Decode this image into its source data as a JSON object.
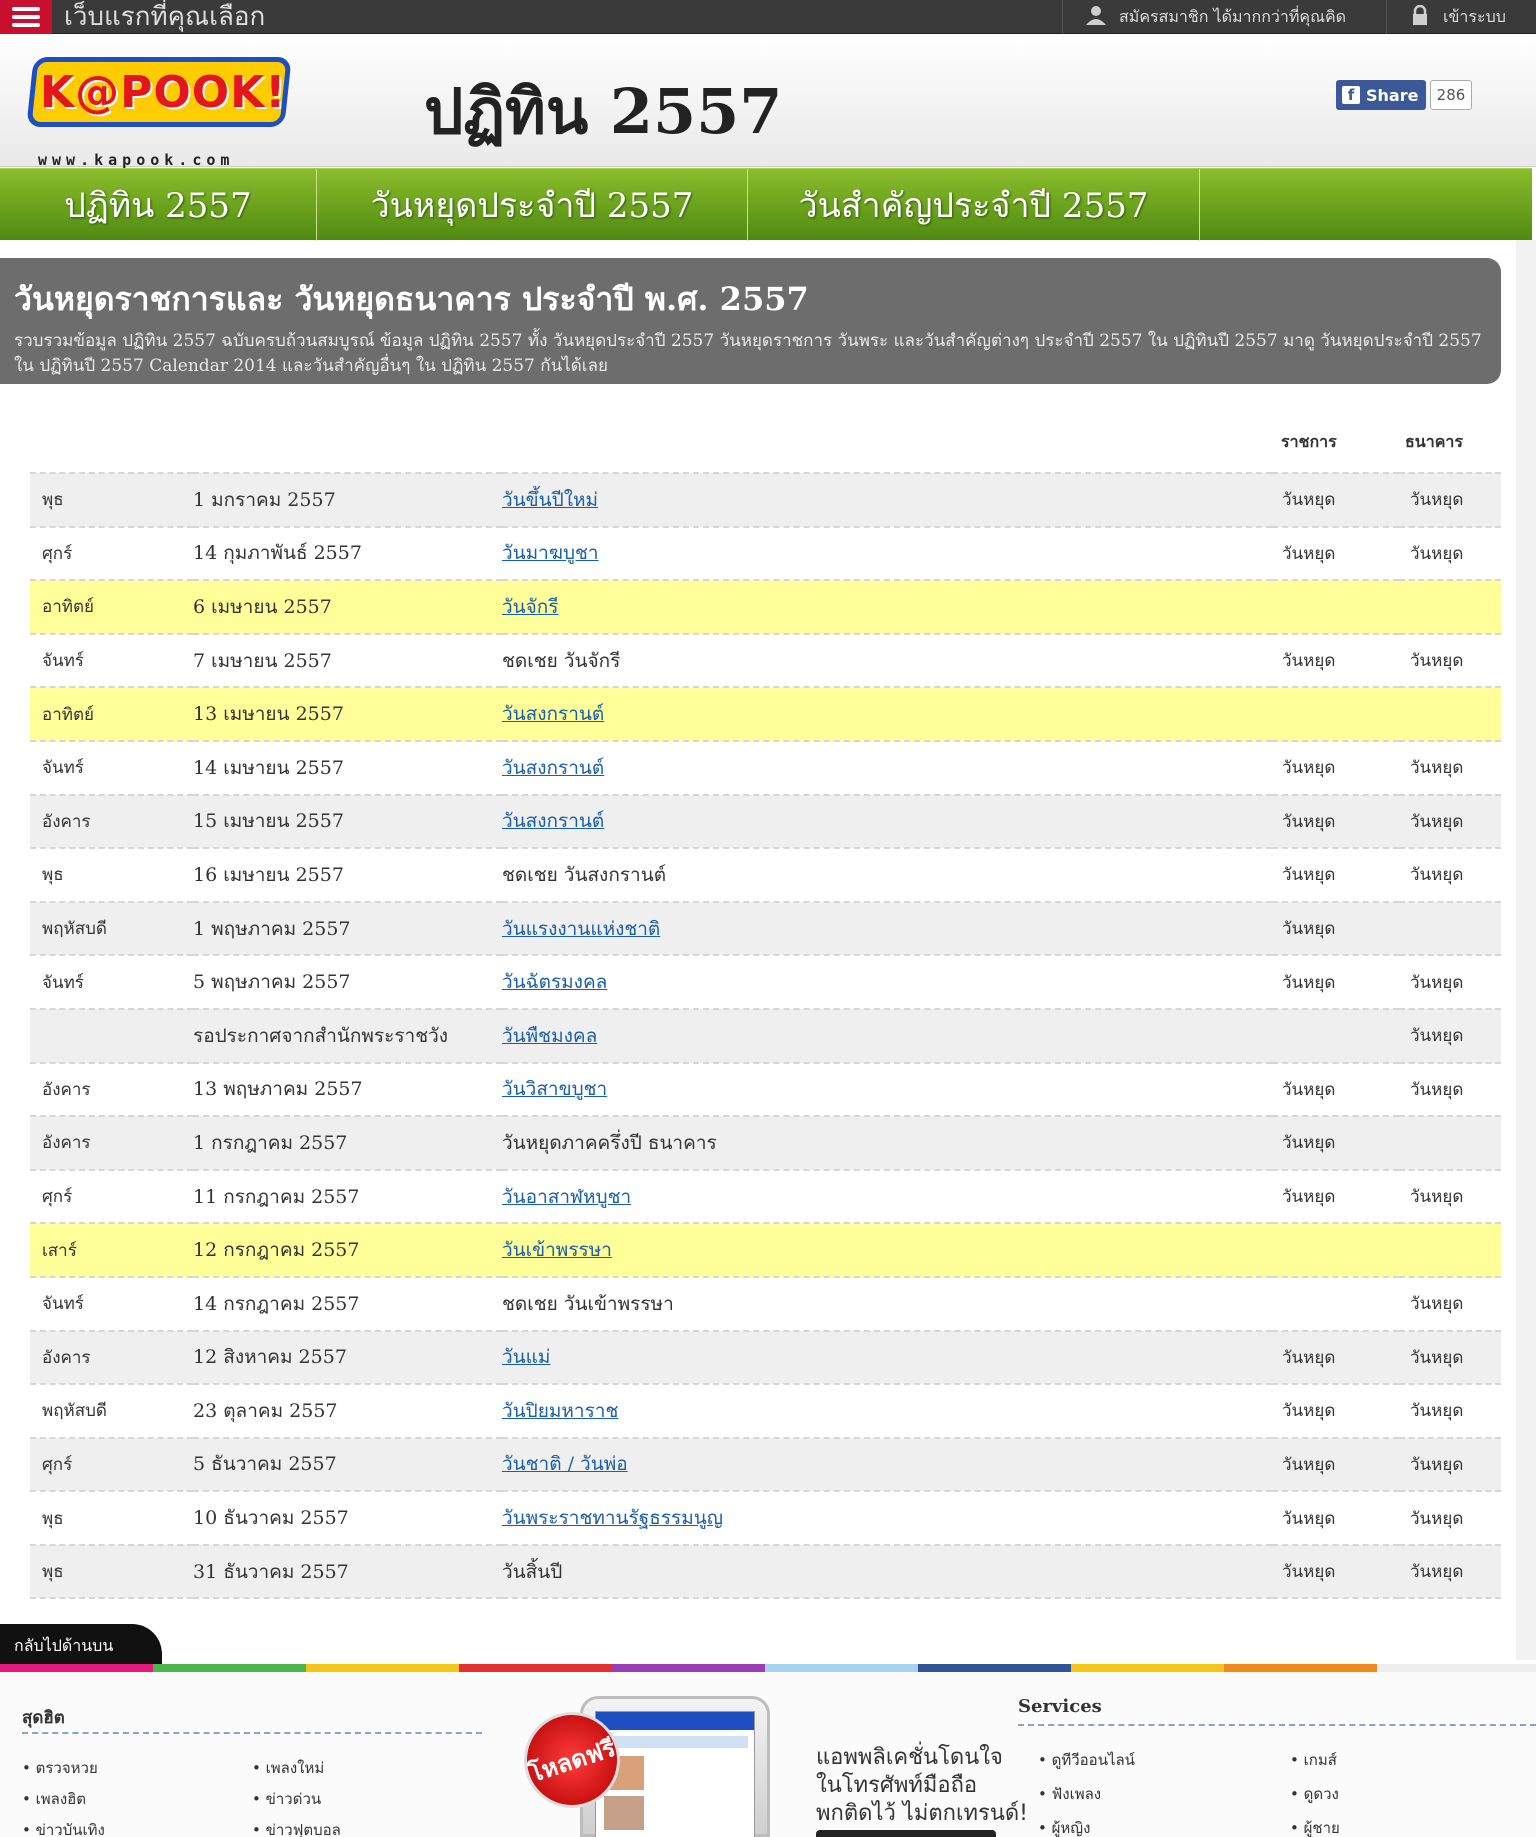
{
  "topbar": {
    "tagline": "เว็บแรกที่คุณเลือก",
    "member_label": "สมัครสมาชิก ได้มากกว่าที่คุณคิด",
    "login_label": "เข้าระบบ"
  },
  "header": {
    "logo_text": "K@POOK!",
    "logo_url": "www.kapook.com",
    "title": "ปฏิทิน 2557",
    "share_label": "Share",
    "share_count": "286"
  },
  "nav": {
    "items": [
      {
        "label": "ปฏิทิน 2557"
      },
      {
        "label": "วันหยุดประจำปี 2557"
      },
      {
        "label": "วันสำคัญประจำปี 2557"
      }
    ]
  },
  "intro": {
    "heading": "วันหยุดราชการและ วันหยุดธนาคาร ประจำปี พ.ศ. 2557",
    "text": "รวบรวมข้อมูล ปฏิทิน 2557 ฉบับครบถ้วนสมบูรณ์ ข้อมูล ปฏิทิน 2557 ทั้ง วันหยุดประจำปี 2557 วันหยุดราชการ วันพระ และวันสำคัญต่างๆ ประจำปี 2557 ใน ปฏิทินปี 2557 มาดู วันหยุดประจำปี 2557 ใน ปฏิทินปี 2557 Calendar 2014 และวันสำคัญอื่นๆ ใน ปฏิทิน 2557 กันได้เลย"
  },
  "table": {
    "col_gov": "ราชการ",
    "col_bank": "ธนาคาร",
    "rows": [
      {
        "day": "พุธ",
        "date": "1 มกราคม 2557",
        "name": "วันขึ้นปีใหม่",
        "link": true,
        "gov": "วันหยุด",
        "bank": "วันหยุด",
        "weekend": false
      },
      {
        "day": "ศุกร์",
        "date": "14 กุมภาพันธ์ 2557",
        "name": "วันมาฆบูชา",
        "link": true,
        "gov": "วันหยุด",
        "bank": "วันหยุด",
        "weekend": false
      },
      {
        "day": "อาทิตย์",
        "date": "6 เมษายน 2557",
        "name": "วันจักรี",
        "link": true,
        "gov": "",
        "bank": "",
        "weekend": true
      },
      {
        "day": "จันทร์",
        "date": "7 เมษายน 2557",
        "name": "ชดเชย วันจักรี",
        "link": false,
        "gov": "วันหยุด",
        "bank": "วันหยุด",
        "weekend": false
      },
      {
        "day": "อาทิตย์",
        "date": "13 เมษายน 2557",
        "name": "วันสงกรานต์",
        "link": true,
        "gov": "",
        "bank": "",
        "weekend": true
      },
      {
        "day": "จันทร์",
        "date": "14 เมษายน 2557",
        "name": "วันสงกรานต์",
        "link": true,
        "gov": "วันหยุด",
        "bank": "วันหยุด",
        "weekend": false
      },
      {
        "day": "อังคาร",
        "date": "15 เมษายน 2557",
        "name": "วันสงกรานต์",
        "link": true,
        "gov": "วันหยุด",
        "bank": "วันหยุด",
        "weekend": false
      },
      {
        "day": "พุธ",
        "date": "16 เมษายน 2557",
        "name": "ชดเชย วันสงกรานต์",
        "link": false,
        "gov": "วันหยุด",
        "bank": "วันหยุด",
        "weekend": false
      },
      {
        "day": "พฤหัสบดี",
        "date": "1 พฤษภาคม 2557",
        "name": "วันแรงงานแห่งชาติ",
        "link": true,
        "gov": "วันหยุด",
        "bank": "",
        "weekend": false
      },
      {
        "day": "จันทร์",
        "date": "5 พฤษภาคม 2557",
        "name": "วันฉัตรมงคล",
        "link": true,
        "gov": "วันหยุด",
        "bank": "วันหยุด",
        "weekend": false
      },
      {
        "day": "",
        "date": "รอประกาศจากสำนักพระราชวัง",
        "name": "วันพืชมงคล",
        "link": true,
        "gov": "",
        "bank": "วันหยุด",
        "weekend": false
      },
      {
        "day": "อังคาร",
        "date": "13 พฤษภาคม 2557",
        "name": "วันวิสาขบูชา",
        "link": true,
        "gov": "วันหยุด",
        "bank": "วันหยุด",
        "weekend": false
      },
      {
        "day": "อังคาร",
        "date": "1 กรกฎาคม 2557",
        "name": "วันหยุดภาคครึ่งปี ธนาคาร",
        "link": false,
        "gov": "วันหยุด",
        "bank": "",
        "weekend": false
      },
      {
        "day": "ศุกร์",
        "date": "11 กรกฎาคม 2557",
        "name": "วันอาสาฬหบูชา",
        "link": true,
        "gov": "วันหยุด",
        "bank": "วันหยุด",
        "weekend": false
      },
      {
        "day": "เสาร์",
        "date": "12 กรกฎาคม 2557",
        "name": "วันเข้าพรรษา",
        "link": true,
        "gov": "",
        "bank": "",
        "weekend": true
      },
      {
        "day": "จันทร์",
        "date": "14 กรกฎาคม 2557",
        "name": "ชดเชย วันเข้าพรรษา",
        "link": false,
        "gov": "",
        "bank": "วันหยุด",
        "weekend": false
      },
      {
        "day": "อังคาร",
        "date": "12 สิงหาคม 2557",
        "name": "วันแม่",
        "link": true,
        "gov": "วันหยุด",
        "bank": "วันหยุด",
        "weekend": false
      },
      {
        "day": "พฤหัสบดี",
        "date": "23 ตุลาคม 2557",
        "name": "วันปิยมหาราช",
        "link": true,
        "gov": "วันหยุด",
        "bank": "วันหยุด",
        "weekend": false
      },
      {
        "day": "ศุกร์",
        "date": "5 ธันวาคม 2557",
        "name": "วันชาติ / วันพ่อ",
        "link": true,
        "gov": "วันหยุด",
        "bank": "วันหยุด",
        "weekend": false
      },
      {
        "day": "พุธ",
        "date": "10 ธันวาคม 2557",
        "name": "วันพระราชทานรัฐธรรมนูญ",
        "link": true,
        "gov": "วันหยุด",
        "bank": "วันหยุด",
        "weekend": false
      },
      {
        "day": "พุธ",
        "date": "31 ธันวาคม 2557",
        "name": "วันสิ้นปี",
        "link": false,
        "gov": "วันหยุด",
        "bank": "วันหยุด",
        "weekend": false
      }
    ]
  },
  "back_to_top": "กลับไปด้านบน",
  "colorbar": [
    "#e8197a",
    "#49b848",
    "#f6c519",
    "#e4312b",
    "#9b3db5",
    "#a6d3ef",
    "#2f5597",
    "#f6c519",
    "#f08a1d",
    "#eeeeee"
  ],
  "footer": {
    "hits_title": "สุดฮิต",
    "hits_col1": [
      "ตรวจหวย",
      "เพลงฮิต",
      "ข่าวบันเทิง"
    ],
    "hits_col2": [
      "เพลงใหม่",
      "ข่าวด่วน",
      "ข่าวฟุตบอล"
    ],
    "app_badge": "โหลดฟรี",
    "app_text_1": "แอพพลิเคชั่นโดนใจ",
    "app_text_2": "ในโทรศัพท์มือถือ",
    "app_text_3": "พกติดไว้ ไม่ตกเทรนด์!",
    "services_title": "Services",
    "services_col1": [
      "ดูทีวีออนไลน์",
      "ฟังเพลง",
      "ผู้หญิง"
    ],
    "services_col2": [
      "เกมส์",
      "ดูดวง",
      "ผู้ชาย"
    ]
  }
}
